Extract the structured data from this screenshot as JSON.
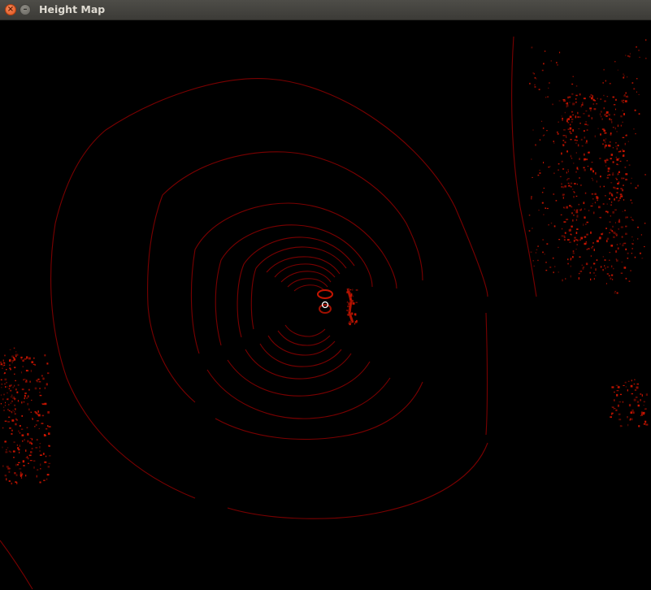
{
  "window": {
    "title": "Height Map",
    "close_icon": "close-icon",
    "minimize_icon": "minimize-icon",
    "close_glyph": "×",
    "minimize_glyph": "–"
  },
  "visualization": {
    "background_color": "#000000",
    "ring_color": "#7a0000",
    "point_color": "#c41400",
    "center_marker_color": "#ffffff"
  }
}
